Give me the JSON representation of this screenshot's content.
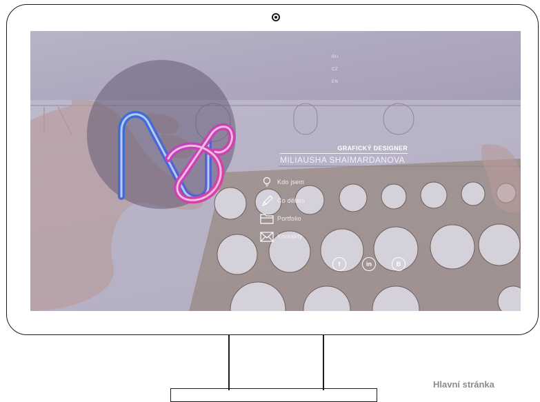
{
  "languages": [
    "RU",
    "CZ",
    "EN"
  ],
  "hero": {
    "title": "GRAFICKÝ DESIGNER",
    "name": "MILIAUSHA SHAIMARDANOVA"
  },
  "menu": [
    {
      "label": "Kdo jsem",
      "icon": "lightbulb-icon"
    },
    {
      "label": "Co dělám",
      "icon": "pencil-icon"
    },
    {
      "label": "Portfolio",
      "icon": "folder-icon"
    },
    {
      "label": "Kontakty",
      "icon": "envelope-icon"
    }
  ],
  "social": [
    {
      "label": "f",
      "icon": "facebook-icon"
    },
    {
      "label": "in",
      "icon": "linkedin-icon"
    },
    {
      "label": "B",
      "icon": "behance-icon"
    }
  ],
  "caption": "Hlavní stránka",
  "colors": {
    "logo_blue": "#3a6fd8",
    "logo_pink": "#e0409a",
    "overlay": "#a69fb8",
    "frame": "#1a1a1a",
    "caption": "#8b8b8b"
  }
}
